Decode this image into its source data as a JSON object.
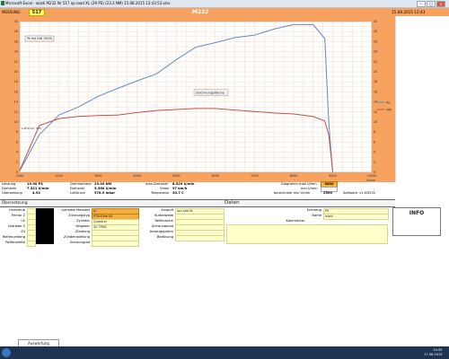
{
  "window": {
    "title": "Microsoft Excel - wizdi  M232  Nr 517  op.road XL (29 PS) (23.3 NM) 15.08.2015 12:43:53.xlsx"
  },
  "header": {
    "mess_label": "MESSUNG:",
    "id": "517",
    "model": "M232",
    "datetime": "15.08.2015 12:43"
  },
  "chart_data": {
    "type": "line",
    "x": [
      1000,
      1500,
      2000,
      2500,
      3000,
      3500,
      4000,
      4500,
      5000,
      5500,
      6000,
      6500,
      7000,
      7500,
      8000,
      8500,
      8800,
      8900,
      9000
    ],
    "xlim": [
      1000,
      10000
    ],
    "xticks": [
      "1000",
      "2000",
      "3000",
      "4000",
      "5000",
      "6000",
      "7000",
      "8000",
      "9000",
      "10000"
    ],
    "xlabel": "U/min",
    "ylim_left": [
      0,
      30
    ],
    "ylim_right": [
      0,
      30
    ],
    "yticks_left": [
      "0",
      "2",
      "4",
      "6",
      "8",
      "10",
      "12",
      "14",
      "16",
      "18",
      "20",
      "22",
      "24",
      "26",
      "28",
      "30"
    ],
    "yticks_right": [
      "0",
      "2",
      "4",
      "6",
      "8",
      "10",
      "12",
      "14",
      "16",
      "18",
      "20",
      "22",
      "24",
      "26",
      "28",
      "30"
    ],
    "series": [
      {
        "name": "PS",
        "color": "#5b8fc9",
        "values": [
          0.3,
          7.5,
          11.4,
          13.0,
          15.1,
          16.7,
          18.2,
          19.6,
          22.4,
          24.9,
          25.8,
          26.8,
          27.3,
          28.5,
          29.4,
          29.4,
          26.6,
          10.0,
          0.0
        ]
      },
      {
        "name": "NM",
        "color": "#c0504d",
        "values": [
          0.4,
          9.3,
          10.7,
          11.1,
          11.3,
          11.4,
          11.9,
          12.3,
          12.5,
          12.7,
          12.7,
          12.4,
          12.1,
          11.8,
          11.6,
          11.1,
          10.2,
          7.5,
          0.3
        ]
      }
    ],
    "annotations": [
      "PS mit DIN 70020",
      "Zeichnungsfläche",
      "Luftdruck: 978"
    ]
  },
  "grid": {
    "leistung_lbl": "Leistung",
    "leistung_val": "19.90 PS",
    "drehmoment_lbl": "Drehmoment",
    "drehmoment_val": "23.49 NM",
    "maxdrehz_lbl": "max.Drehzahl",
    "maxdrehz_val": "8.529 U/min",
    "diagramm_lbl": "Diagramm max U/min",
    "diagramm_val": "9000",
    "drehzahl1_lbl": "Drehzahl",
    "drehzahl1_val": "7.521 U/min",
    "drehzahl2_lbl": "Drehzahl",
    "drehzahl2_val": "5.360 U/min",
    "vmax_lbl": "Vmax",
    "vmax_val": "97 km/h",
    "min_lbl": "min U/min",
    "min_val": "",
    "ubersetz_lbl": "Übersetzung",
    "ubersetz_val": "4.92",
    "luftdruck_lbl": "Luftdruck",
    "luftdruck_val": "978.9 mbar",
    "temp_lbl": "Temperatur",
    "temp_val": "30.7 C",
    "berechnete_lbl": "berechnete min U/min",
    "berechnete_val": "2500",
    "software_lbl": "Software: v1.M3232"
  },
  "ubersicht": {
    "title": "Übersetzung",
    "daten": "Daten",
    "left_rows": [
      "Hinterhub",
      "Primar Z",
      "Ck",
      "Getriebe Z",
      "Z4",
      "Reifenumfang",
      "Reifenbreite"
    ],
    "mid_labels": [
      "Getriebe Messdet",
      "Zündungstyp",
      "Zylinder",
      "Vergaser",
      "Zündung",
      "Zündeinstellung",
      "Schwungrad"
    ],
    "mid_values": [
      "ja",
      "PTM-Ride Kit",
      "Quantrei",
      "30 TPMX",
      "",
      "",
      ""
    ],
    "right_labels": [
      "Auspuff",
      "Kurbelwelle",
      "Reifenmark",
      "Schwungsrad",
      "Ansaugsystem",
      "Bedüsung"
    ],
    "right_values": [
      "op.road XL",
      "",
      "",
      "",
      "",
      ""
    ],
    "far_labels": [
      "Fahrzeug",
      "Name",
      "Kommentar"
    ],
    "far_values": [
      "PX",
      "wizdi",
      ""
    ],
    "info": "INFO"
  },
  "sheet_tab": "Auswertung",
  "clock": {
    "time": "14:35",
    "date": "17.08.2015"
  }
}
